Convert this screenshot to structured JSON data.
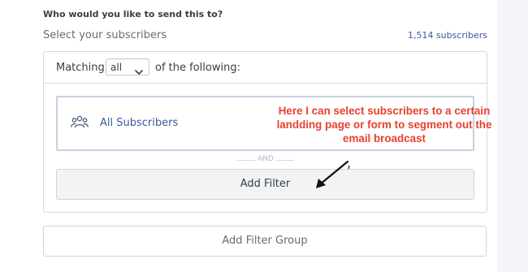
{
  "header": {
    "question": "Who would you like to send this to?",
    "subtitle": "Select your subscribers",
    "subscriber_count": "1,514 subscribers"
  },
  "filter_panel": {
    "match_prefix": "Matching",
    "match_select_value": "all",
    "match_suffix": "of the following:",
    "filters": [
      {
        "icon": "users-icon",
        "label": "All Subscribers"
      }
    ],
    "separator_label": "AND",
    "add_filter_label": "Add Filter"
  },
  "add_filter_group_label": "Add Filter Group",
  "annotation": {
    "lines": [
      "Here I can select subscribers to a certain",
      "landding page or form to segment out the",
      "email broadcast"
    ],
    "color": "#e8412f"
  },
  "colors": {
    "link_blue": "#3a5a9a",
    "border": "#d5d9de",
    "text": "#373f45"
  }
}
